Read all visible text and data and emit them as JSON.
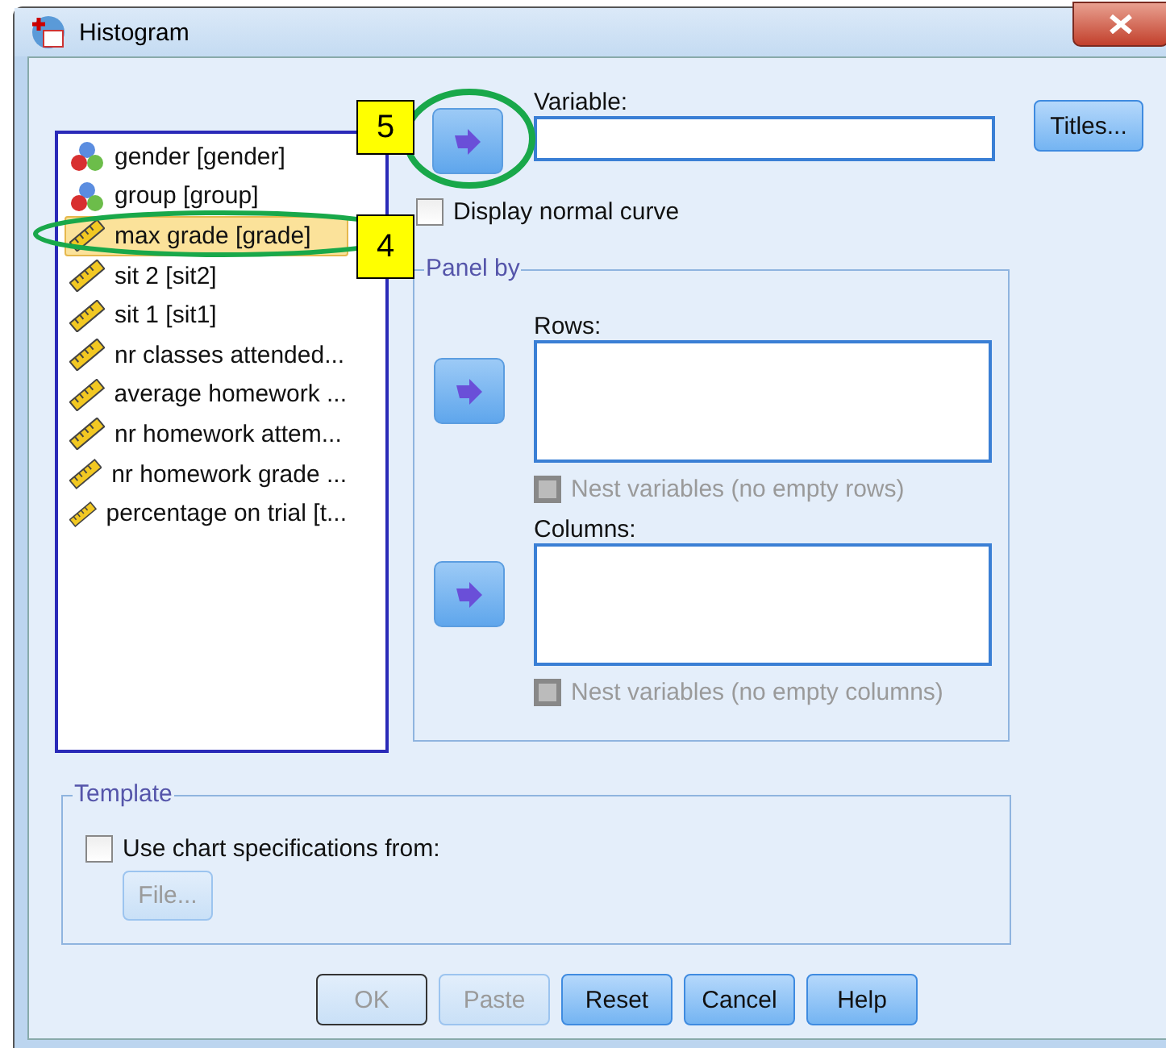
{
  "window": {
    "title": "Histogram"
  },
  "variables": [
    {
      "label": "gender [gender]",
      "kind": "nominal",
      "selected": false
    },
    {
      "label": "group [group]",
      "kind": "nominal",
      "selected": false
    },
    {
      "label": "max grade [grade]",
      "kind": "scale",
      "selected": true
    },
    {
      "label": "sit 2 [sit2]",
      "kind": "scale",
      "selected": false
    },
    {
      "label": "sit 1 [sit1]",
      "kind": "scale",
      "selected": false
    },
    {
      "label": "nr classes attended...",
      "kind": "scale",
      "selected": false
    },
    {
      "label": "average homework ...",
      "kind": "scale",
      "selected": false
    },
    {
      "label": "nr homework attem...",
      "kind": "scale",
      "selected": false
    },
    {
      "label": "nr homework grade ...",
      "kind": "scale",
      "selected": false
    },
    {
      "label": "percentage on trial [t...",
      "kind": "scale",
      "selected": false
    }
  ],
  "variable_field": {
    "label": "Variable:"
  },
  "display_normal_curve": {
    "label": "Display normal curve",
    "checked": false
  },
  "panel_by": {
    "title": "Panel by",
    "rows": {
      "label": "Rows:",
      "nest": {
        "label": "Nest variables (no empty rows)",
        "checked": false,
        "disabled": true
      }
    },
    "columns": {
      "label": "Columns:",
      "nest": {
        "label": "Nest variables (no empty columns)",
        "checked": false,
        "disabled": true
      }
    }
  },
  "titles_button": "Titles...",
  "template": {
    "title": "Template",
    "use_spec": {
      "label": "Use chart specifications from:",
      "checked": false
    },
    "file_button": {
      "label": "File...",
      "disabled": true
    }
  },
  "buttons": [
    {
      "label": "OK",
      "disabled": true,
      "default": true
    },
    {
      "label": "Paste",
      "disabled": true,
      "default": false
    },
    {
      "label": "Reset",
      "disabled": false,
      "default": false
    },
    {
      "label": "Cancel",
      "disabled": false,
      "default": false
    },
    {
      "label": "Help",
      "disabled": false,
      "default": false
    }
  ],
  "annotations": [
    {
      "text": "5"
    },
    {
      "text": "4"
    }
  ]
}
